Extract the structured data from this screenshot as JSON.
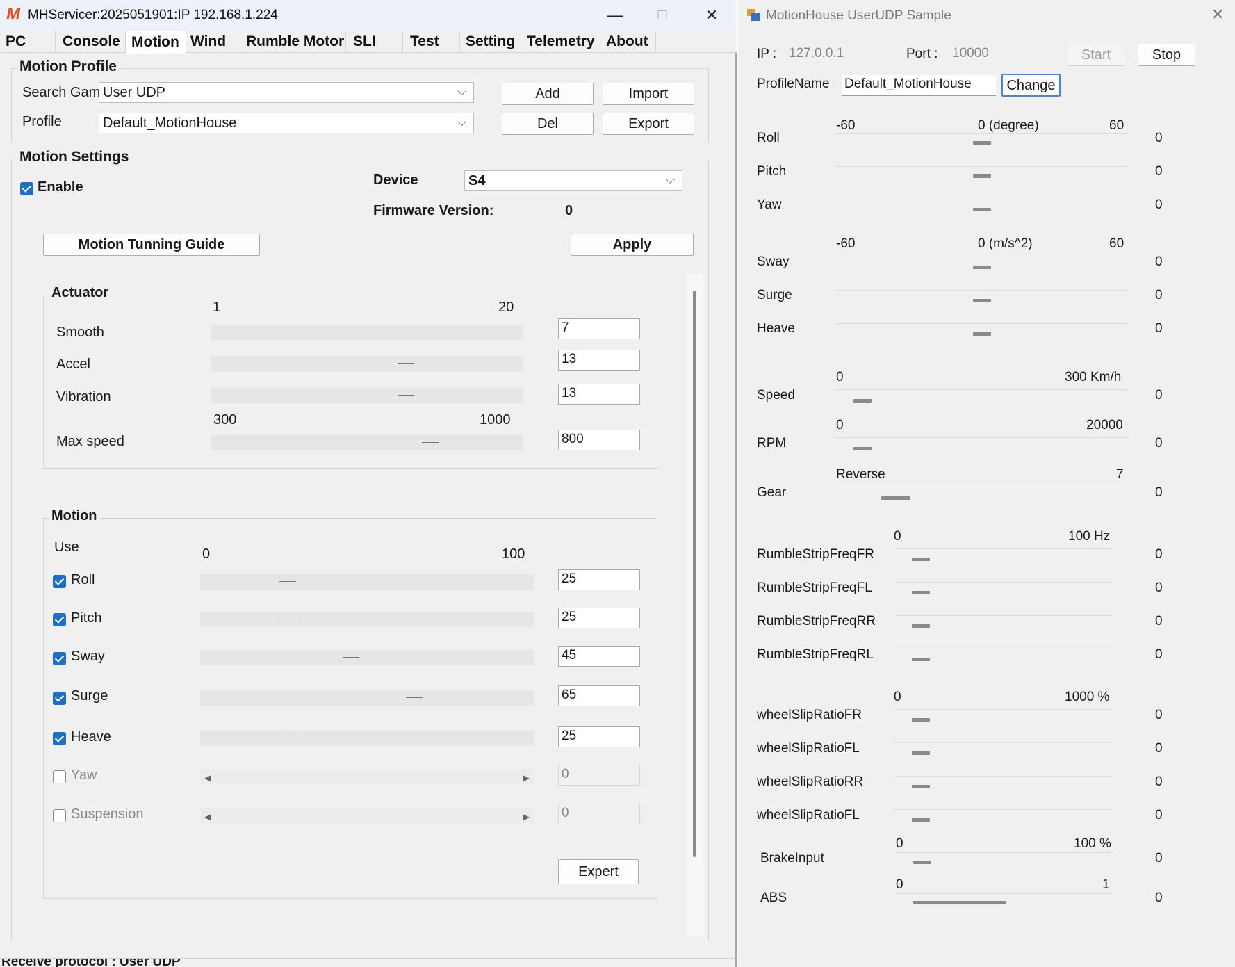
{
  "left": {
    "title": "MHServicer:2025051901:IP 192.168.1.224",
    "window_controls": {
      "minimize": "—",
      "maximize": "☐",
      "close": "✕"
    },
    "tabs": [
      "PC",
      "Console",
      "Motion",
      "Wind",
      "Rumble Motor",
      "SLI",
      "Test",
      "Setting",
      "Telemetry",
      "About"
    ],
    "active_tab": "Motion",
    "motion_profile": {
      "title": "Motion Profile",
      "search_label": "Search Gam",
      "search_value": "User UDP",
      "profile_label": "Profile",
      "profile_value": "Default_MotionHouse",
      "add": "Add",
      "import": "Import",
      "del": "Del",
      "export": "Export"
    },
    "motion_settings": {
      "title": "Motion Settings",
      "enable_label": "Enable",
      "enable_checked": true,
      "device_label": "Device",
      "device_value": "S4",
      "firmware_label": "Firmware Version:",
      "firmware_value": "0",
      "guide_button": "Motion Tunning Guide",
      "apply_button": "Apply"
    },
    "actuator": {
      "title": "Actuator",
      "range1_min": "1",
      "range1_max": "20",
      "range2_min": "300",
      "range2_max": "1000",
      "rows": [
        {
          "label": "Smooth",
          "value": "7",
          "min": 1,
          "max": 20
        },
        {
          "label": "Accel",
          "value": "13",
          "min": 1,
          "max": 20
        },
        {
          "label": "Vibration",
          "value": "13",
          "min": 1,
          "max": 20
        },
        {
          "label": "Max speed",
          "value": "800",
          "min": 300,
          "max": 1000
        }
      ]
    },
    "motion": {
      "title": "Motion",
      "use_label": "Use",
      "range_min": "0",
      "range_max": "100",
      "rows": [
        {
          "label": "Roll",
          "value": "25",
          "checked": true
        },
        {
          "label": "Pitch",
          "value": "25",
          "checked": true
        },
        {
          "label": "Sway",
          "value": "45",
          "checked": true
        },
        {
          "label": "Surge",
          "value": "65",
          "checked": true
        },
        {
          "label": "Heave",
          "value": "25",
          "checked": true
        },
        {
          "label": "Yaw",
          "value": "0",
          "checked": false
        },
        {
          "label": "Suspension",
          "value": "0",
          "checked": false
        }
      ],
      "expert_button": "Expert"
    },
    "status_text": "Receive protocol : User UDP"
  },
  "right": {
    "title": "MotionHouse UserUDP Sample",
    "close": "✕",
    "ip_label": "IP :",
    "ip_value": "127.0.0.1",
    "port_label": "Port :",
    "port_value": "10000",
    "start": "Start",
    "stop": "Stop",
    "profile_name_label": "ProfileName",
    "profile_name_value": "Default_MotionHouse",
    "change": "Change",
    "scales": {
      "degree": {
        "min": "-60",
        "mid": "0 (degree)",
        "max": "60"
      },
      "accel": {
        "min": "-60",
        "mid": "0 (m/s^2)",
        "max": "60"
      },
      "speed": {
        "min": "0",
        "max": "300 Km/h"
      },
      "rpm": {
        "min": "0",
        "max": "20000"
      },
      "gear": {
        "min": "Reverse",
        "max": "7"
      },
      "hz": {
        "min": "0",
        "max": "100 Hz"
      },
      "pct1000": {
        "min": "0",
        "max": "1000 %"
      },
      "pct100": {
        "min": "0",
        "max": "100 %"
      },
      "abs": {
        "min": "0",
        "max": "1"
      }
    },
    "rows": {
      "roll": {
        "label": "Roll",
        "value": "0"
      },
      "pitch": {
        "label": "Pitch",
        "value": "0"
      },
      "yaw": {
        "label": "Yaw",
        "value": "0"
      },
      "sway": {
        "label": "Sway",
        "value": "0"
      },
      "surge": {
        "label": "Surge",
        "value": "0"
      },
      "heave": {
        "label": "Heave",
        "value": "0"
      },
      "speed": {
        "label": "Speed",
        "value": "0"
      },
      "rpm": {
        "label": "RPM",
        "value": "0"
      },
      "gear": {
        "label": "Gear",
        "value": "0"
      },
      "rsfr": {
        "label": "RumbleStripFreqFR",
        "value": "0"
      },
      "rsfl": {
        "label": "RumbleStripFreqFL",
        "value": "0"
      },
      "rsrr": {
        "label": "RumbleStripFreqRR",
        "value": "0"
      },
      "rsrl": {
        "label": "RumbleStripFreqRL",
        "value": "0"
      },
      "wsfr": {
        "label": "wheelSlipRatioFR",
        "value": "0"
      },
      "wsfl": {
        "label": "wheelSlipRatioFL",
        "value": "0"
      },
      "wsrr": {
        "label": "wheelSlipRatioRR",
        "value": "0"
      },
      "wsfl2": {
        "label": "wheelSlipRatioFL",
        "value": "0"
      },
      "brake": {
        "label": "BrakeInput",
        "value": "0"
      },
      "abs": {
        "label": "ABS",
        "value": "0"
      }
    }
  }
}
